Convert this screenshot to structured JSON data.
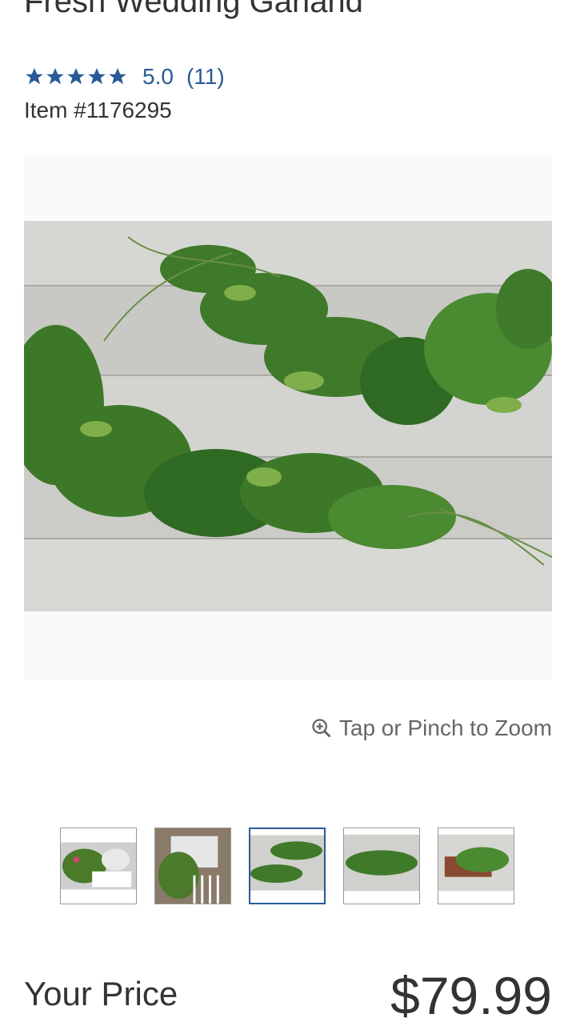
{
  "product": {
    "title": "Fresh Wedding Garland",
    "rating": {
      "stars": 5,
      "value": "5.0",
      "count": "(11)"
    },
    "item_number": "Item #1176295"
  },
  "image_viewer": {
    "zoom_hint": "Tap or Pinch to Zoom",
    "thumbnails": [
      {
        "name": "thumb-1",
        "active": false
      },
      {
        "name": "thumb-2",
        "active": false
      },
      {
        "name": "thumb-3",
        "active": true
      },
      {
        "name": "thumb-4",
        "active": false
      },
      {
        "name": "thumb-5",
        "active": false
      }
    ]
  },
  "pricing": {
    "label": "Your Price",
    "value": "$79.99"
  },
  "colors": {
    "accent": "#2a5a96",
    "text": "#333333"
  }
}
